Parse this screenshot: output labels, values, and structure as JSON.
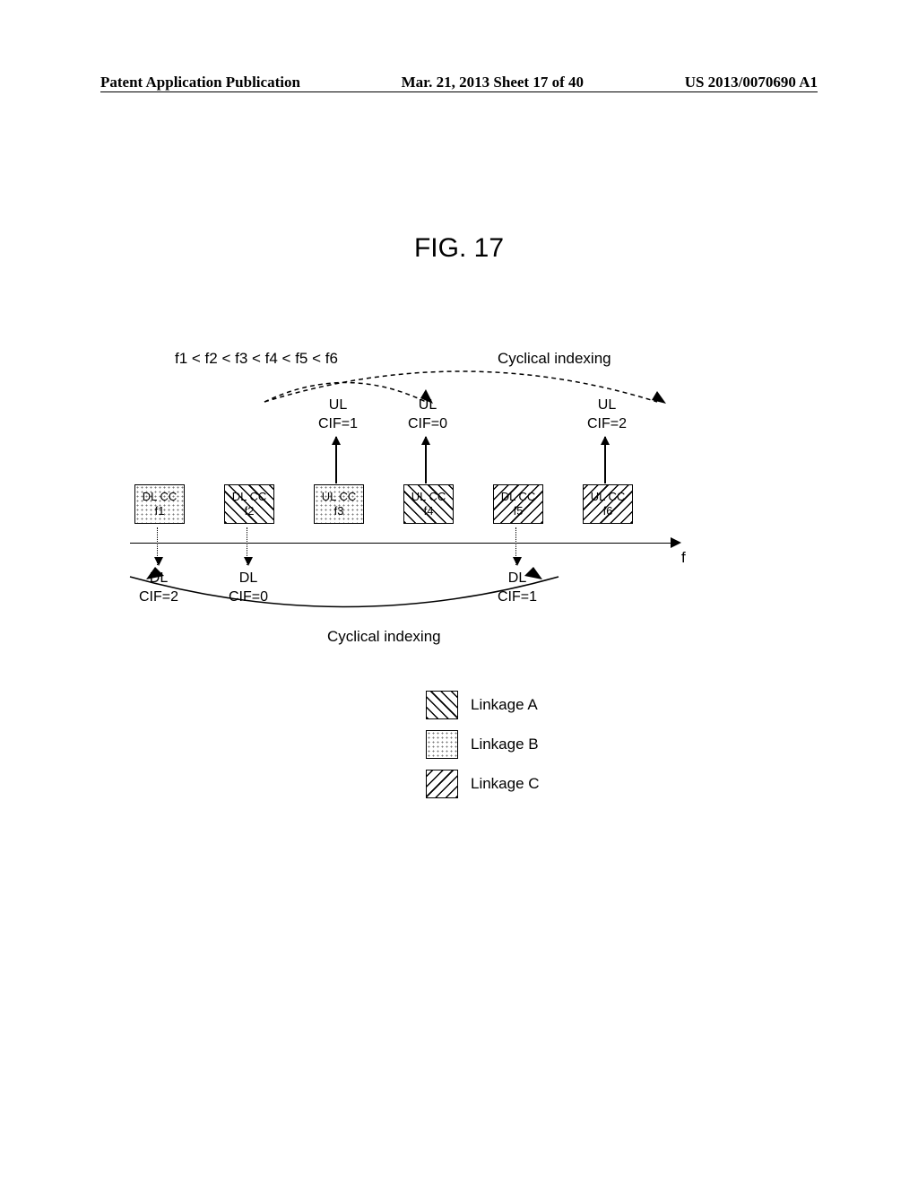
{
  "header": {
    "left": "Patent Application Publication",
    "center": "Mar. 21, 2013  Sheet 17 of 40",
    "right": "US 2013/0070690 A1"
  },
  "figure_title": "FIG. 17",
  "freq_order": "f1 < f2 < f3 < f4 < f5 < f6",
  "cyclical_label_top": "Cyclical indexing",
  "cyclical_label_bottom": "Cyclical indexing",
  "axis_label": "f",
  "boxes": [
    {
      "line1": "DL CC",
      "line2": "f1",
      "pattern": "b"
    },
    {
      "line1": "DL CC",
      "line2": "f2",
      "pattern": "a"
    },
    {
      "line1": "UL CC",
      "line2": "f3",
      "pattern": "b"
    },
    {
      "line1": "UL CC",
      "line2": "f4",
      "pattern": "a"
    },
    {
      "line1": "DL CC",
      "line2": "f5",
      "pattern": "c"
    },
    {
      "line1": "UL CC",
      "line2": "f6",
      "pattern": "c"
    }
  ],
  "ul_labels": [
    {
      "l1": "UL",
      "l2": "CIF=1"
    },
    {
      "l1": "UL",
      "l2": "CIF=0"
    },
    {
      "l1": "UL",
      "l2": "CIF=2"
    }
  ],
  "dl_labels": [
    {
      "l1": "DL",
      "l2": "CIF=2"
    },
    {
      "l1": "DL",
      "l2": "CIF=0"
    },
    {
      "l1": "DL",
      "l2": "CIF=1"
    }
  ],
  "legend": [
    {
      "label": "Linkage A",
      "pattern": "a"
    },
    {
      "label": "Linkage B",
      "pattern": "b"
    },
    {
      "label": "Linkage C",
      "pattern": "c"
    }
  ]
}
